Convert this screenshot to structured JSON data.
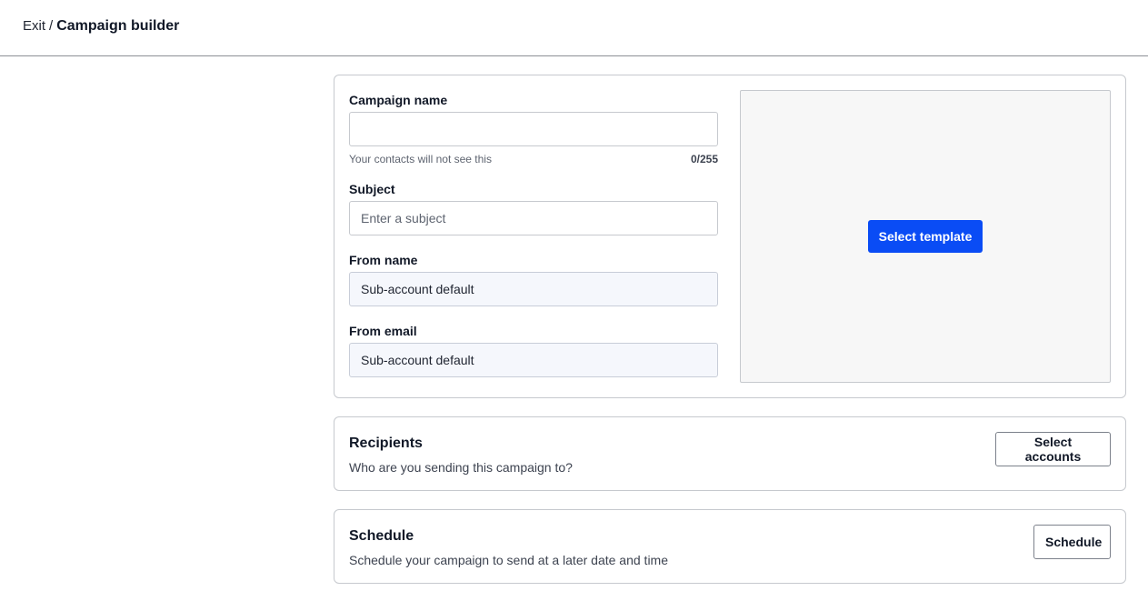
{
  "header": {
    "exit_label": "Exit",
    "separator": "/",
    "title": "Campaign builder"
  },
  "form": {
    "campaign_name": {
      "label": "Campaign name",
      "value": "",
      "placeholder": "",
      "hint": "Your contacts will not see this",
      "counter": "0/255"
    },
    "subject": {
      "label": "Subject",
      "value": "",
      "placeholder": "Enter a subject"
    },
    "from_name": {
      "label": "From name",
      "value": "Sub-account default"
    },
    "from_email": {
      "label": "From email",
      "value": "Sub-account default"
    }
  },
  "template": {
    "button_label": "Select template"
  },
  "recipients": {
    "title": "Recipients",
    "description": "Who are you sending this campaign to?",
    "button_label": "Select accounts"
  },
  "schedule": {
    "title": "Schedule",
    "description": "Schedule your campaign to send at a later date and time",
    "button_label": "Schedule"
  },
  "colors": {
    "primary": "#0a4cf5",
    "readonly_bg": "#f5f7fc",
    "preview_bg": "#f7f7f7",
    "border": "#c6c9ce"
  }
}
